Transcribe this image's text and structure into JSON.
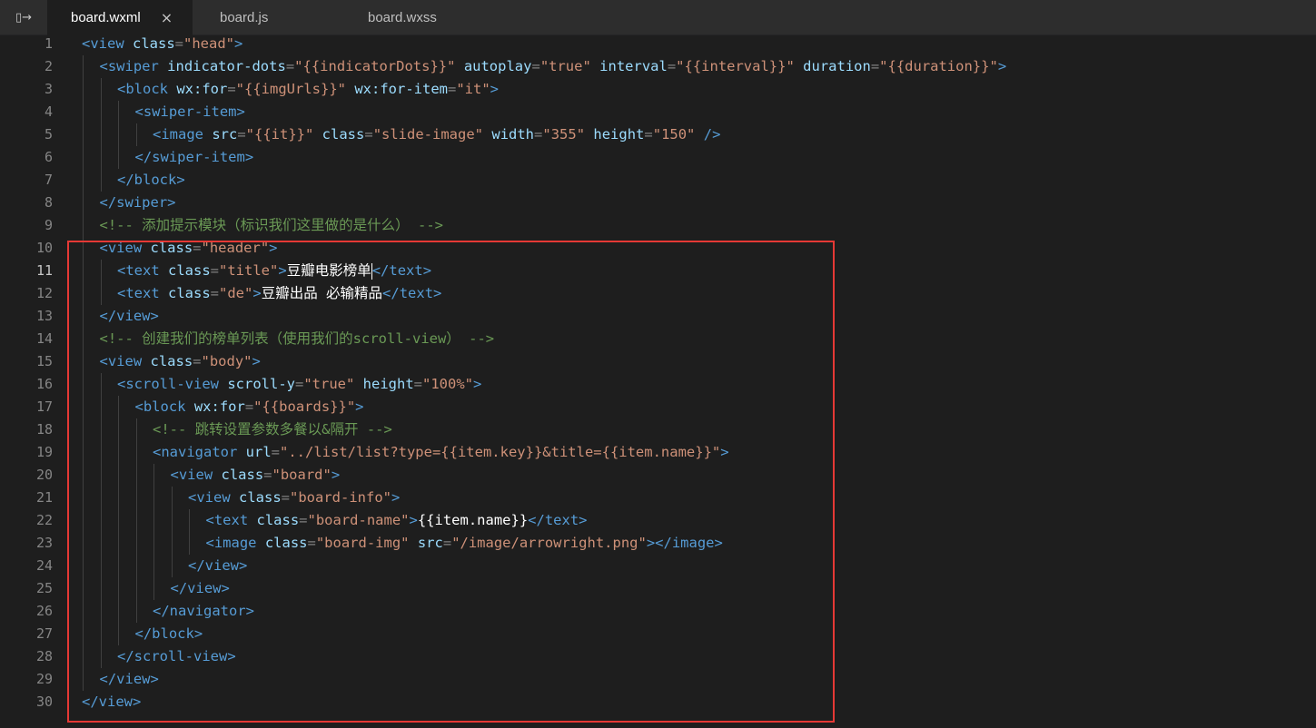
{
  "tabbar": {
    "toggle_label": "▯→",
    "tabs": [
      {
        "label": "board.wxml",
        "active": true
      },
      {
        "label": "board.js",
        "active": false
      },
      {
        "label": "board.wxss",
        "active": false
      }
    ],
    "close_glyph": "×"
  },
  "editor": {
    "current_line": 11,
    "line_numbers": [
      "1",
      "2",
      "3",
      "4",
      "5",
      "6",
      "7",
      "8",
      "9",
      "10",
      "11",
      "12",
      "13",
      "14",
      "15",
      "16",
      "17",
      "18",
      "19",
      "20",
      "21",
      "22",
      "23",
      "24",
      "25",
      "26",
      "27",
      "28",
      "29",
      "30"
    ],
    "lines": [
      {
        "indent": 0,
        "tokens": [
          [
            "t",
            "<view "
          ],
          [
            "a",
            "class"
          ],
          [
            "p",
            "="
          ],
          [
            "s",
            "\"head\""
          ],
          [
            "t",
            ">"
          ]
        ]
      },
      {
        "indent": 1,
        "tokens": [
          [
            "t",
            "<swiper "
          ],
          [
            "a",
            "indicator-dots"
          ],
          [
            "p",
            "="
          ],
          [
            "s",
            "\"{{indicatorDots}}\""
          ],
          [
            "p",
            " "
          ],
          [
            "a",
            "autoplay"
          ],
          [
            "p",
            "="
          ],
          [
            "s",
            "\"true\""
          ],
          [
            "p",
            " "
          ],
          [
            "a",
            "interval"
          ],
          [
            "p",
            "="
          ],
          [
            "s",
            "\"{{interval}}\""
          ],
          [
            "p",
            " "
          ],
          [
            "a",
            "duration"
          ],
          [
            "p",
            "="
          ],
          [
            "s",
            "\"{{duration}}\""
          ],
          [
            "t",
            ">"
          ]
        ]
      },
      {
        "indent": 2,
        "tokens": [
          [
            "t",
            "<block "
          ],
          [
            "a",
            "wx:for"
          ],
          [
            "p",
            "="
          ],
          [
            "s",
            "\"{{imgUrls}}\""
          ],
          [
            "p",
            " "
          ],
          [
            "a",
            "wx:for-item"
          ],
          [
            "p",
            "="
          ],
          [
            "s",
            "\"it\""
          ],
          [
            "t",
            ">"
          ]
        ]
      },
      {
        "indent": 3,
        "tokens": [
          [
            "t",
            "<swiper-item>"
          ]
        ]
      },
      {
        "indent": 4,
        "tokens": [
          [
            "t",
            "<image "
          ],
          [
            "a",
            "src"
          ],
          [
            "p",
            "="
          ],
          [
            "s",
            "\"{{it}}\""
          ],
          [
            "p",
            " "
          ],
          [
            "a",
            "class"
          ],
          [
            "p",
            "="
          ],
          [
            "s",
            "\"slide-image\""
          ],
          [
            "p",
            " "
          ],
          [
            "a",
            "width"
          ],
          [
            "p",
            "="
          ],
          [
            "s",
            "\"355\""
          ],
          [
            "p",
            " "
          ],
          [
            "a",
            "height"
          ],
          [
            "p",
            "="
          ],
          [
            "s",
            "\"150\""
          ],
          [
            "p",
            " "
          ],
          [
            "t",
            "/>"
          ]
        ]
      },
      {
        "indent": 3,
        "tokens": [
          [
            "t",
            "</swiper-item>"
          ]
        ]
      },
      {
        "indent": 2,
        "tokens": [
          [
            "t",
            "</block>"
          ]
        ]
      },
      {
        "indent": 1,
        "tokens": [
          [
            "t",
            "</swiper>"
          ]
        ]
      },
      {
        "indent": 1,
        "tokens": [
          [
            "c",
            "<!-- 添加提示模块（标识我们这里做的是什么） -->"
          ]
        ]
      },
      {
        "indent": 1,
        "tokens": [
          [
            "t",
            "<view "
          ],
          [
            "a",
            "class"
          ],
          [
            "p",
            "="
          ],
          [
            "s",
            "\"header\""
          ],
          [
            "t",
            ">"
          ]
        ]
      },
      {
        "indent": 2,
        "tokens": [
          [
            "t",
            "<text "
          ],
          [
            "a",
            "class"
          ],
          [
            "p",
            "="
          ],
          [
            "s",
            "\"title\""
          ],
          [
            "t",
            ">"
          ],
          [
            "txt",
            "豆瓣电影榜单"
          ],
          [
            "cursor",
            ""
          ],
          [
            "t",
            "</text>"
          ]
        ]
      },
      {
        "indent": 2,
        "tokens": [
          [
            "t",
            "<text "
          ],
          [
            "a",
            "class"
          ],
          [
            "p",
            "="
          ],
          [
            "s",
            "\"de\""
          ],
          [
            "t",
            ">"
          ],
          [
            "txt",
            "豆瓣出品 必输精品"
          ],
          [
            "t",
            "</text>"
          ]
        ]
      },
      {
        "indent": 1,
        "tokens": [
          [
            "t",
            "</view>"
          ]
        ]
      },
      {
        "indent": 1,
        "tokens": [
          [
            "c",
            "<!-- 创建我们的榜单列表（使用我们的scroll-view） -->"
          ]
        ]
      },
      {
        "indent": 1,
        "tokens": [
          [
            "t",
            "<view "
          ],
          [
            "a",
            "class"
          ],
          [
            "p",
            "="
          ],
          [
            "s",
            "\"body\""
          ],
          [
            "t",
            ">"
          ]
        ]
      },
      {
        "indent": 2,
        "tokens": [
          [
            "t",
            "<scroll-view "
          ],
          [
            "a",
            "scroll-y"
          ],
          [
            "p",
            "="
          ],
          [
            "s",
            "\"true\""
          ],
          [
            "p",
            " "
          ],
          [
            "a",
            "height"
          ],
          [
            "p",
            "="
          ],
          [
            "s",
            "\"100%\""
          ],
          [
            "t",
            ">"
          ]
        ]
      },
      {
        "indent": 3,
        "tokens": [
          [
            "t",
            "<block "
          ],
          [
            "a",
            "wx:for"
          ],
          [
            "p",
            "="
          ],
          [
            "s",
            "\"{{boards}}\""
          ],
          [
            "t",
            ">"
          ]
        ]
      },
      {
        "indent": 4,
        "tokens": [
          [
            "c",
            "<!-- 跳转设置参数多餐以&隔开 -->"
          ]
        ]
      },
      {
        "indent": 4,
        "tokens": [
          [
            "t",
            "<navigator "
          ],
          [
            "a",
            "url"
          ],
          [
            "p",
            "="
          ],
          [
            "s",
            "\"../list/list?type={{item.key}}&title={{item.name}}\""
          ],
          [
            "t",
            ">"
          ]
        ]
      },
      {
        "indent": 5,
        "tokens": [
          [
            "t",
            "<view "
          ],
          [
            "a",
            "class"
          ],
          [
            "p",
            "="
          ],
          [
            "s",
            "\"board\""
          ],
          [
            "t",
            ">"
          ]
        ]
      },
      {
        "indent": 6,
        "tokens": [
          [
            "t",
            "<view "
          ],
          [
            "a",
            "class"
          ],
          [
            "p",
            "="
          ],
          [
            "s",
            "\"board-info\""
          ],
          [
            "t",
            ">"
          ]
        ]
      },
      {
        "indent": 7,
        "tokens": [
          [
            "t",
            "<text "
          ],
          [
            "a",
            "class"
          ],
          [
            "p",
            "="
          ],
          [
            "s",
            "\"board-name\""
          ],
          [
            "t",
            ">"
          ],
          [
            "txt",
            "{{item.name}}"
          ],
          [
            "t",
            "</text>"
          ]
        ]
      },
      {
        "indent": 7,
        "tokens": [
          [
            "t",
            "<image "
          ],
          [
            "a",
            "class"
          ],
          [
            "p",
            "="
          ],
          [
            "s",
            "\"board-img\""
          ],
          [
            "p",
            " "
          ],
          [
            "a",
            "src"
          ],
          [
            "p",
            "="
          ],
          [
            "s",
            "\"/image/arrowright.png\""
          ],
          [
            "t",
            "></image>"
          ]
        ]
      },
      {
        "indent": 6,
        "tokens": [
          [
            "t",
            "</view>"
          ]
        ]
      },
      {
        "indent": 5,
        "tokens": [
          [
            "t",
            "</view>"
          ]
        ]
      },
      {
        "indent": 4,
        "tokens": [
          [
            "t",
            "</navigator>"
          ]
        ]
      },
      {
        "indent": 3,
        "tokens": [
          [
            "t",
            "</block>"
          ]
        ]
      },
      {
        "indent": 2,
        "tokens": [
          [
            "t",
            "</scroll-view>"
          ]
        ]
      },
      {
        "indent": 1,
        "tokens": [
          [
            "t",
            "</view>"
          ]
        ]
      },
      {
        "indent": 0,
        "tokens": [
          [
            "t",
            "</view>"
          ]
        ]
      }
    ]
  },
  "colors": {
    "background": "#1e1e1e",
    "tag": "#569cd6",
    "attribute": "#9cdcfe",
    "string": "#ce9178",
    "comment": "#6a9955",
    "highlight_box": "#e53935"
  }
}
